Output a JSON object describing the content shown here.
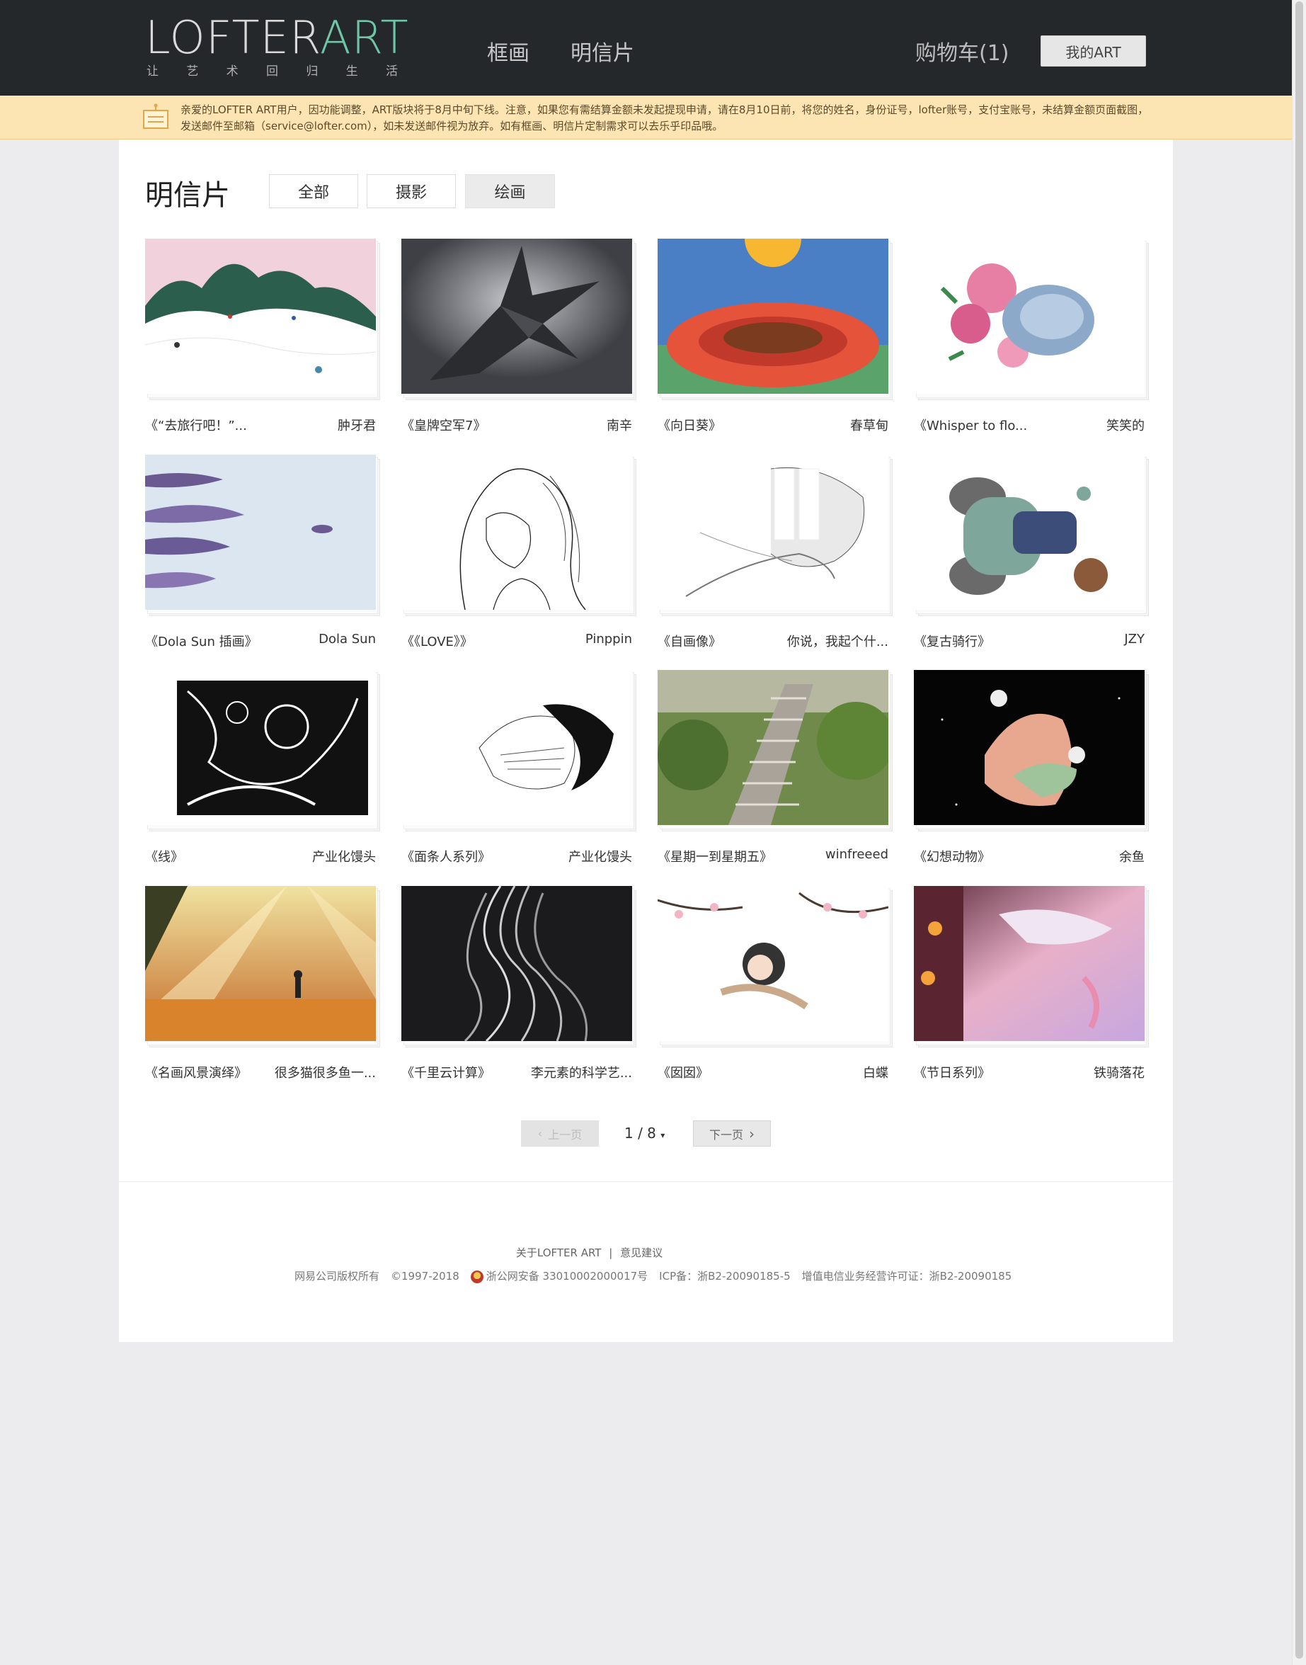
{
  "header": {
    "logo_main": "LOFTER",
    "logo_accent": "ART",
    "slogan": [
      "让",
      "艺",
      "术",
      "回",
      "归",
      "生",
      "活"
    ],
    "nav": [
      "框画",
      "明信片"
    ],
    "cart_label": "购物车(1)",
    "my_art_label": "我的ART"
  },
  "notice": {
    "text": "亲爱的LOFTER ART用户，因功能调整，ART版块将于8月中旬下线。注意，如果您有需结算金额未发起提现申请，请在8月10日前，将您的姓名，身份证号，lofter账号，支付宝账号，未结算金额页面截图，发送邮件至邮箱（service@lofter.com），如未发送邮件视为放弃。如有框画、明信片定制需求可以去乐乎印品哦。"
  },
  "page": {
    "title": "明信片",
    "filters": [
      "全部",
      "摄影",
      "绘画"
    ],
    "active_filter": "绘画"
  },
  "cards": [
    {
      "title": "《“去旅行吧！”...",
      "author": "肿牙君",
      "icon": "ski-painting"
    },
    {
      "title": "《皇牌空军7》",
      "author": "南辛",
      "icon": "jet-painting"
    },
    {
      "title": "《向日葵》",
      "author": "春草甸",
      "icon": "sunflower-painting"
    },
    {
      "title": "《Whisper to flo...",
      "author": "笑笑的",
      "icon": "cat-flower-painting"
    },
    {
      "title": "《Dola Sun 插画》",
      "author": "Dola Sun",
      "icon": "dancers-painting"
    },
    {
      "title": "《《LOVE》》",
      "author": "Pinppin",
      "icon": "girl-sketch"
    },
    {
      "title": "《自画像》",
      "author": "你说，我起个什...",
      "icon": "self-portrait-sketch"
    },
    {
      "title": "《复古骑行》",
      "author": "JZY",
      "icon": "scooter-painting"
    },
    {
      "title": "《线》",
      "author": "产业化馒头",
      "icon": "line-art-painting"
    },
    {
      "title": "《面条人系列》",
      "author": "产业化馒头",
      "icon": "noodle-head-painting"
    },
    {
      "title": "《星期一到星期五》",
      "author": "winfreeed",
      "icon": "stairs-garden-painting"
    },
    {
      "title": "《幻想动物》",
      "author": "余鱼",
      "icon": "fantasy-animal-painting"
    },
    {
      "title": "《名画风景演绎》",
      "author": "很多猫很多鱼一...",
      "icon": "sunbeam-field-painting"
    },
    {
      "title": "《千里云计算》",
      "author": "李元素的科学艺...",
      "icon": "flowing-lines-painting"
    },
    {
      "title": "《囡囡》",
      "author": "白蝶",
      "icon": "blossom-girl-painting"
    },
    {
      "title": "《节日系列》",
      "author": "铁骑落花",
      "icon": "festival-painting"
    }
  ],
  "pagination": {
    "prev_label": "上一页",
    "next_label": "下一页",
    "current": "1 / 8"
  },
  "footer": {
    "about": "关于LOFTER ART",
    "sep": "|",
    "feedback": "意见建议",
    "copyright": "网易公司版权所有",
    "years": "©1997-2018",
    "police": "浙公网安备 33010002000017号",
    "icp": "ICP备：浙B2-20090185-5",
    "telecom": "增值电信业务经营许可证：浙B2-20090185"
  }
}
